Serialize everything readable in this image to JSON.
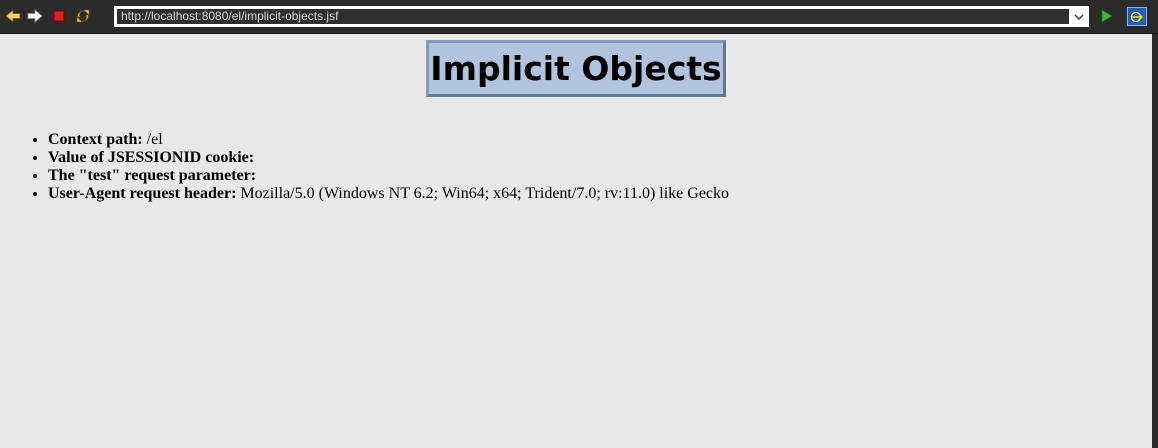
{
  "browser": {
    "url": "http://localhost:8080/el/implicit-objects.jsf",
    "icons": {
      "back": "back-arrow-icon",
      "forward": "forward-arrow-icon",
      "stop": "stop-icon",
      "refresh": "refresh-icon",
      "dropdown": "chevron-down-icon",
      "go": "play-icon",
      "external": "external-browser-icon"
    }
  },
  "page": {
    "title": "Implicit Objects",
    "items": [
      {
        "label": "Context path:",
        "value": "/el"
      },
      {
        "label": "Value of JSESSIONID cookie:",
        "value": ""
      },
      {
        "label": "The \"test\" request parameter:",
        "value": ""
      },
      {
        "label": "User-Agent request header:",
        "value": "Mozilla/5.0 (Windows NT 6.2; Win64; x64; Trident/7.0; rv:11.0) like Gecko"
      }
    ]
  },
  "colors": {
    "title_bg": "#b0c4de",
    "title_border": "#5b7a99",
    "page_bg": "#e8e8e8",
    "toolbar_bg": "#2b2b2b"
  }
}
